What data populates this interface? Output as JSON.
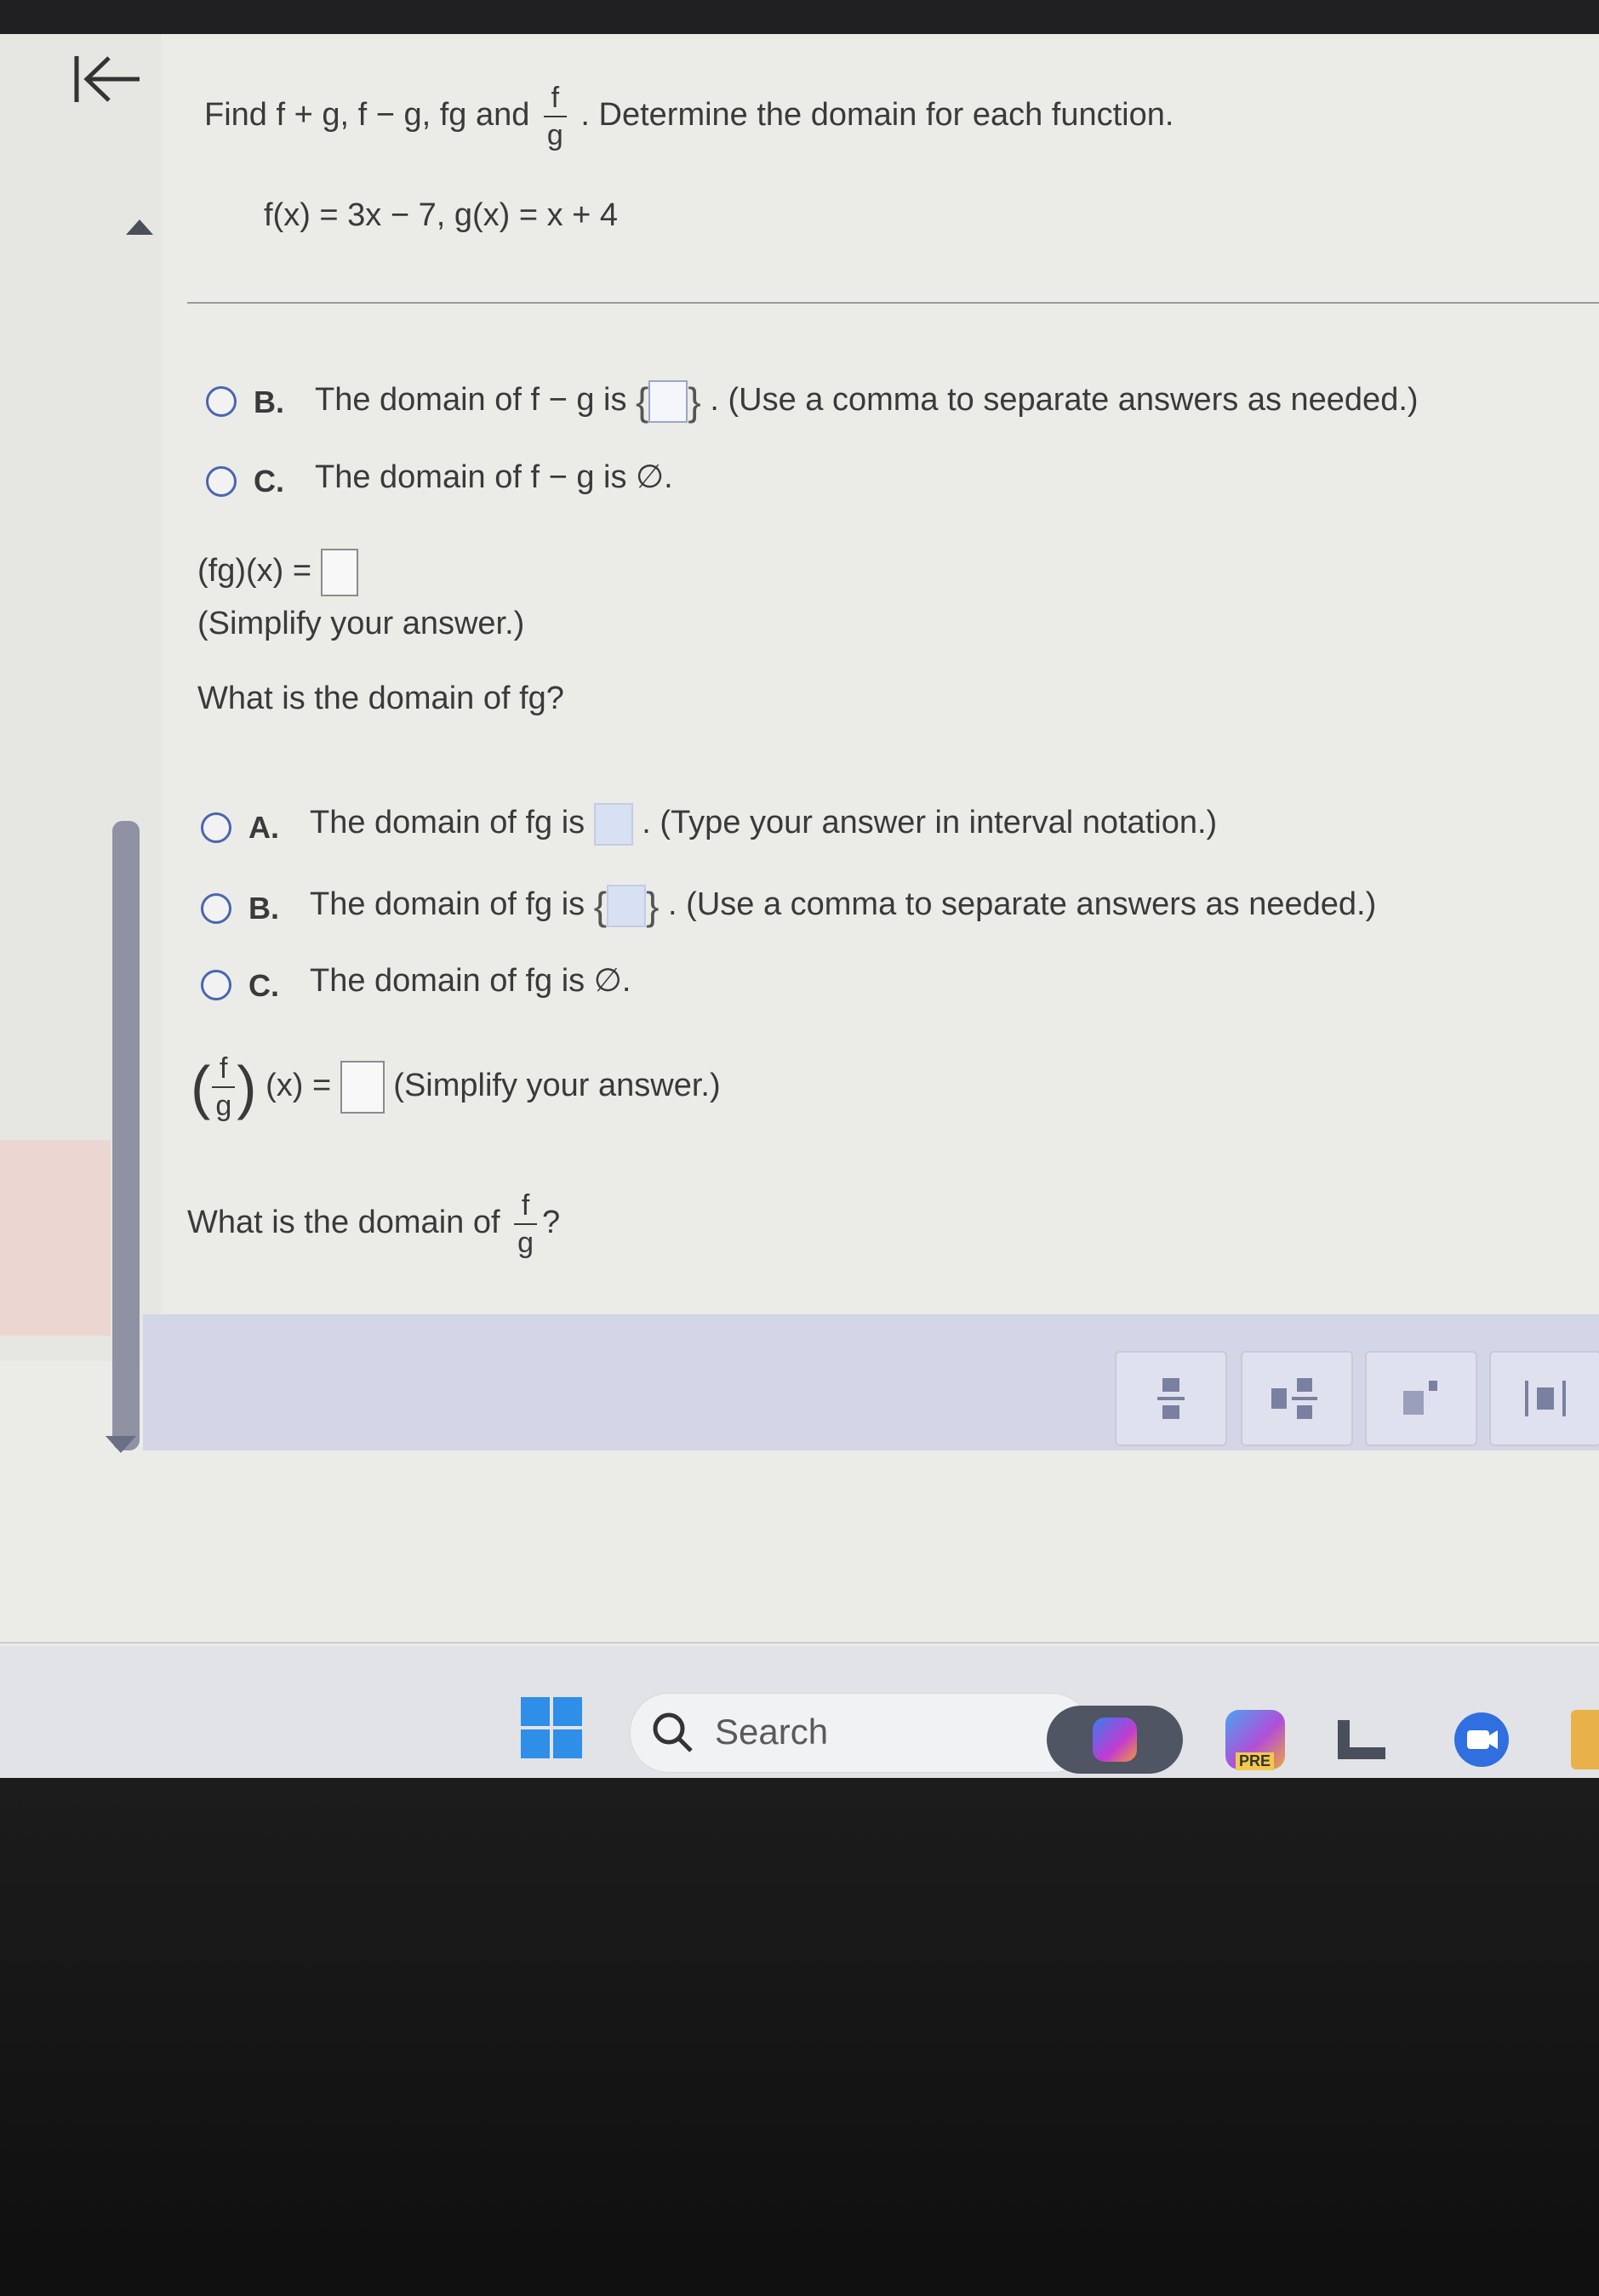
{
  "question": {
    "intro_prefix": "Find f + g, f − g, fg and",
    "intro_frac_num": "f",
    "intro_frac_den": "g",
    "intro_suffix": ". Determine the domain for each function.",
    "functions": "f(x) = 3x − 7, g(x) = x + 4"
  },
  "fminusg_options": [
    {
      "letter": "B.",
      "prefix": "The domain of f − g is",
      "brace_open": "{",
      "brace_close": "}",
      "suffix": ". (Use a comma to separate answers as needed.)"
    },
    {
      "letter": "C.",
      "text": "The domain of f − g is ∅."
    }
  ],
  "fg": {
    "expr": "(fg)(x) =",
    "hint": "(Simplify your answer.)",
    "domain_question": "What is the domain of fg?"
  },
  "fg_options": [
    {
      "letter": "A.",
      "prefix": "The domain of fg is",
      "suffix": ". (Type your answer in interval notation.)"
    },
    {
      "letter": "B.",
      "prefix": "The domain of fg is",
      "brace_open": "{",
      "brace_close": "}",
      "suffix": ". (Use a comma to separate answers as needed.)"
    },
    {
      "letter": "C.",
      "text": "The domain of fg is ∅."
    }
  ],
  "fdivg": {
    "paren_open": "(",
    "frac_num": "f",
    "frac_den": "g",
    "paren_close": ")",
    "expr_suffix": "(x) =",
    "hint": "(Simplify your answer.)",
    "domain_prefix": "What is the domain of",
    "domain_suffix": "?"
  },
  "toolbar": {
    "buttons": [
      {
        "icon": "fraction-icon"
      },
      {
        "icon": "mixed-number-icon"
      },
      {
        "icon": "exponent-icon"
      },
      {
        "icon": "absolute-value-icon"
      }
    ]
  },
  "taskbar": {
    "search_label": "Search",
    "pre_badge": "PRE"
  },
  "colors": {
    "radio_border": "#4a66b0",
    "scrollbar": "#8f92a3",
    "toolbar_bg": "#d2d6e6"
  }
}
